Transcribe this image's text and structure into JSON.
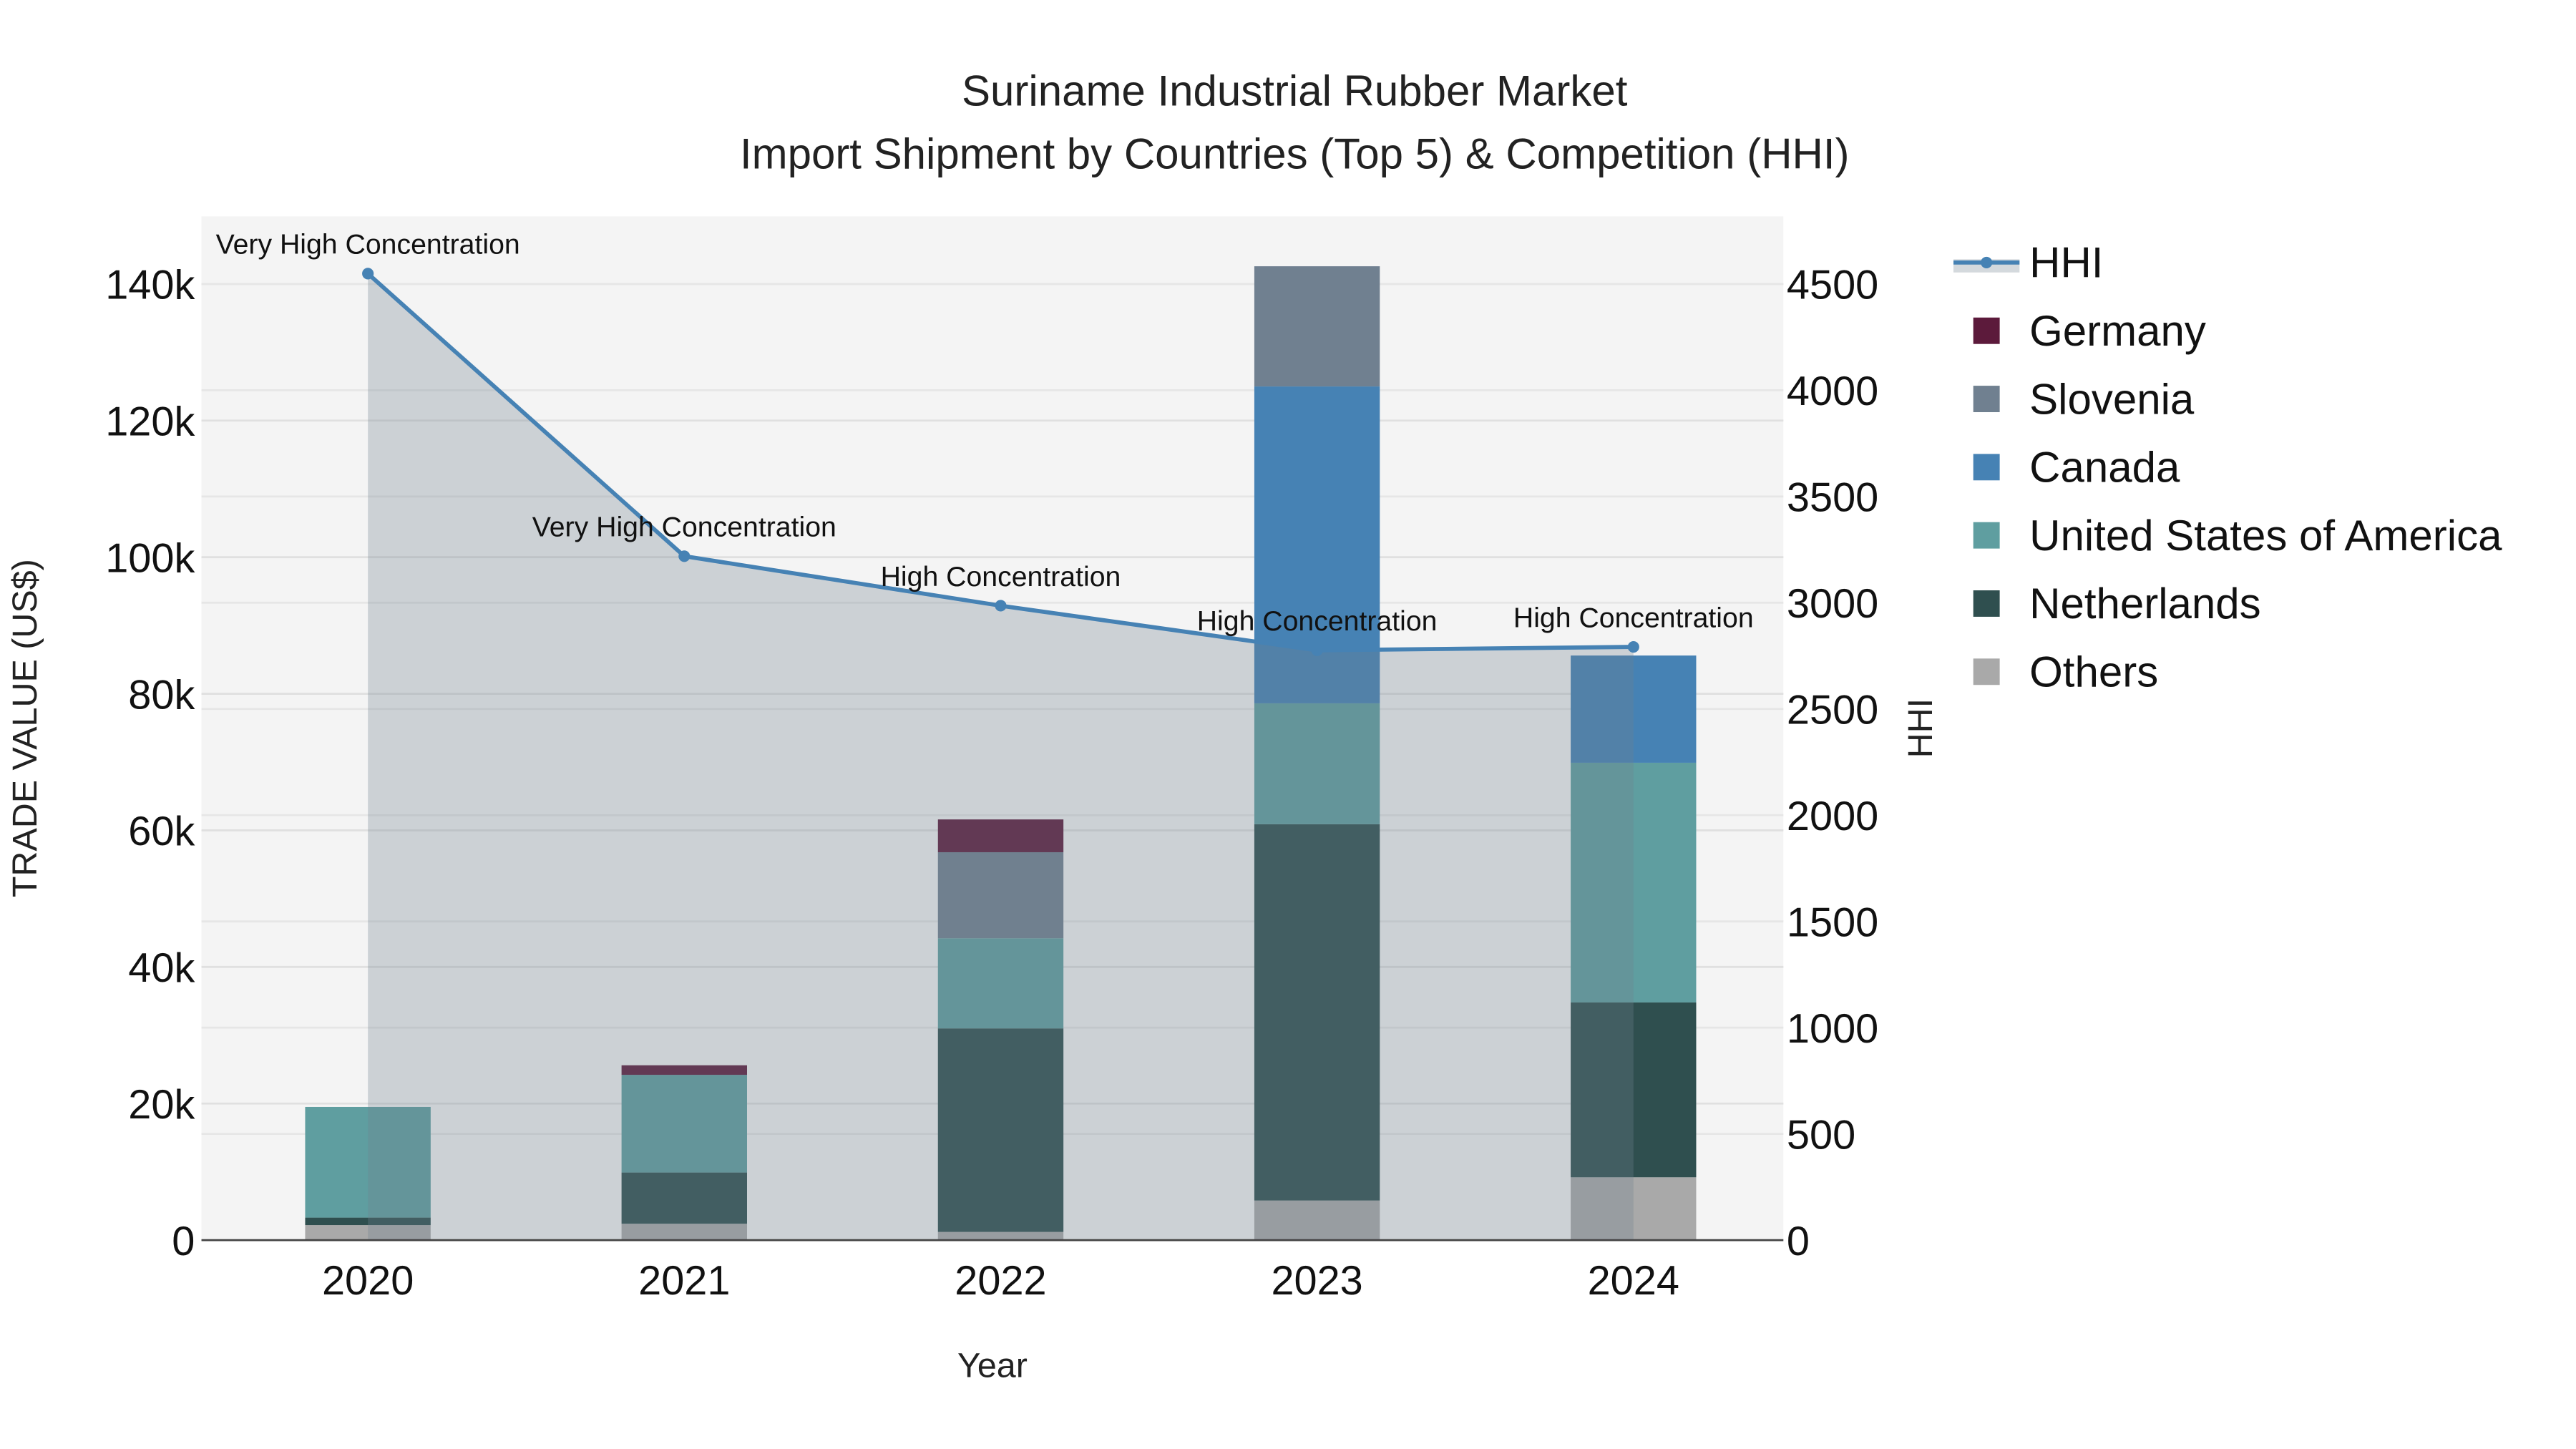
{
  "chart_data": {
    "type": "bar",
    "title": "Suriname Industrial Rubber Market",
    "subtitle": "Import Shipment by Countries (Top 5) & Competition (HHI)",
    "xlabel": "Year",
    "ylabel": "TRADE VALUE (US$)",
    "y2label": "HHI",
    "categories": [
      "2020",
      "2021",
      "2022",
      "2023",
      "2024"
    ],
    "ylim": [
      0,
      150000
    ],
    "y2lim": [
      0,
      4800
    ],
    "yticks": [
      0,
      20000,
      40000,
      60000,
      80000,
      100000,
      120000,
      140000
    ],
    "ytick_labels": [
      "0",
      "20k",
      "40k",
      "60k",
      "80k",
      "100k",
      "120k",
      "140k"
    ],
    "y2ticks": [
      0,
      500,
      1000,
      1500,
      2000,
      2500,
      3000,
      3500,
      4000,
      4500
    ],
    "y2tick_labels": [
      "0",
      "500",
      "1000",
      "1500",
      "2000",
      "2500",
      "3000",
      "3500",
      "4000",
      "4500"
    ],
    "legend_position": "right",
    "stacking_order": [
      "Others",
      "Netherlands",
      "United States of America",
      "Canada",
      "Slovenia",
      "Germany"
    ],
    "series": [
      {
        "name": "Germany",
        "color": "#5c1a3b",
        "values": [
          0,
          1400,
          4800,
          0,
          0
        ]
      },
      {
        "name": "Slovenia",
        "color": "#708090",
        "values": [
          0,
          0,
          12600,
          17600,
          0
        ]
      },
      {
        "name": "Canada",
        "color": "#4682b4",
        "values": [
          0,
          0,
          0,
          46400,
          15700
        ]
      },
      {
        "name": "United States of America",
        "color": "#5f9ea0",
        "values": [
          16200,
          14300,
          13200,
          17700,
          35100
        ]
      },
      {
        "name": "Netherlands",
        "color": "#2f4f4f",
        "values": [
          1100,
          7500,
          29800,
          55100,
          25600
        ]
      },
      {
        "name": "Others",
        "color": "#a9a9a9",
        "values": [
          2200,
          2400,
          1200,
          5800,
          9200
        ]
      }
    ],
    "hhi": {
      "name": "HHI",
      "color": "#4682b4",
      "values": [
        4549,
        3219,
        2986,
        2776,
        2792
      ],
      "annotations": [
        "Very High Concentration",
        "Very High Concentration",
        "High Concentration",
        "High Concentration",
        "High Concentration"
      ]
    },
    "legend": [
      "HHI",
      "Germany",
      "Slovenia",
      "Canada",
      "United States of America",
      "Netherlands",
      "Others"
    ]
  }
}
